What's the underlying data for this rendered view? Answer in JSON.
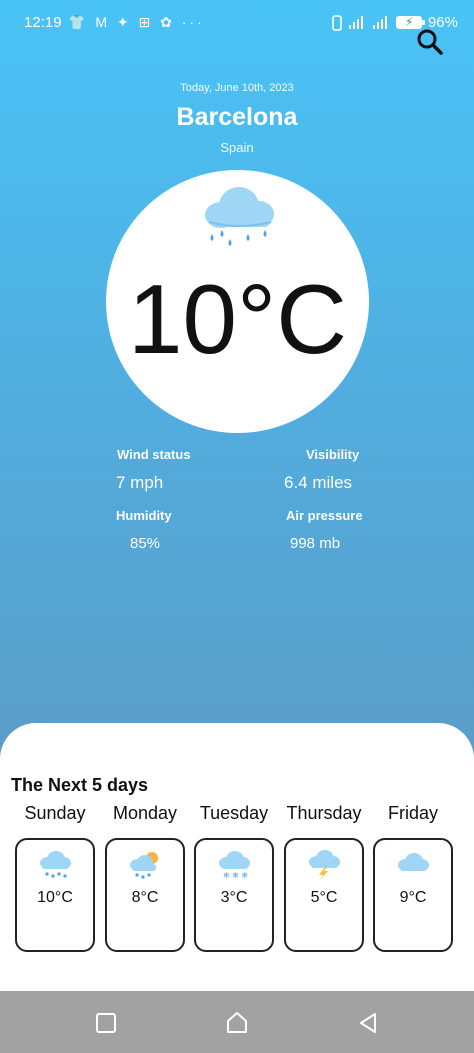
{
  "status_bar": {
    "time": "12:19",
    "left_icons": "👕 M ✦ ⊞ ✿ ···",
    "battery": "96%"
  },
  "header": {
    "date": "Today, June 10th, 2023",
    "city": "Barcelona",
    "country": "Spain"
  },
  "current": {
    "temperature": "10°C",
    "icon": "cloud-rain-icon"
  },
  "stats": {
    "wind_label": "Wind status",
    "wind_value": "7 mph",
    "visibility_label": "Visibility",
    "visibility_value": "6.4 miles",
    "humidity_label": "Humidity",
    "humidity_value": "85%",
    "pressure_label": "Air pressure",
    "pressure_value": "998 mb"
  },
  "forecast": {
    "title": "The Next 5 days",
    "days": [
      {
        "name": "Sunday",
        "temp": "10°C",
        "icon": "cloud-rain-icon"
      },
      {
        "name": "Monday",
        "temp": "8°C",
        "icon": "sun-cloud-rain-icon"
      },
      {
        "name": "Tuesday",
        "temp": "3°C",
        "icon": "cloud-snow-icon"
      },
      {
        "name": "Thursday",
        "temp": "5°C",
        "icon": "cloud-lightning-icon"
      },
      {
        "name": "Friday",
        "temp": "9°C",
        "icon": "cloud-icon"
      }
    ]
  },
  "colors": {
    "sky_top": "#49c3f7",
    "sky_bottom": "#5f98c0",
    "cloud": "#9fd6f5",
    "rain": "#4aa3e3"
  }
}
